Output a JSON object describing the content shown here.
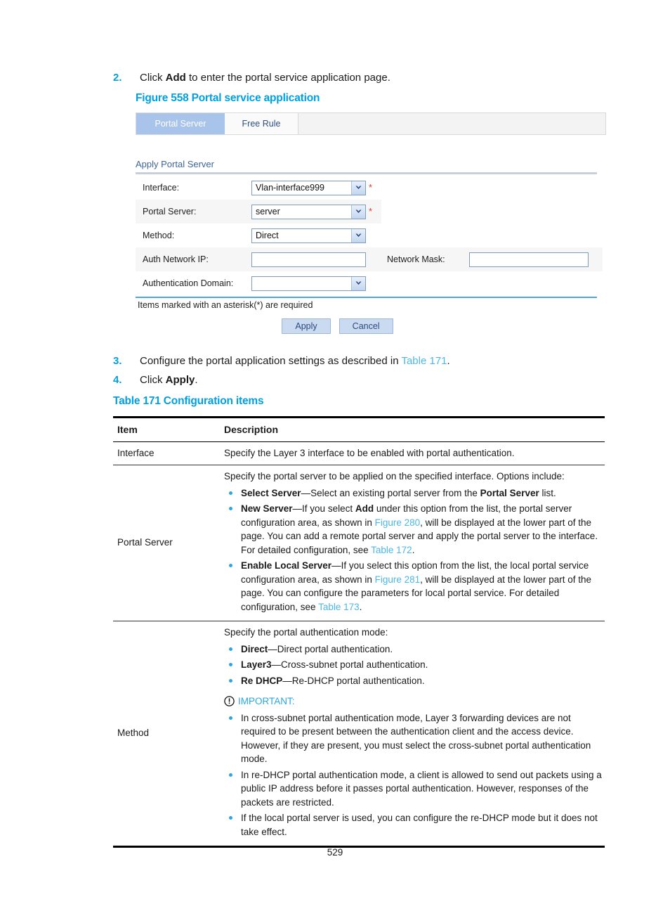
{
  "steps": {
    "step2": {
      "num": "2.",
      "pre": "Click ",
      "bold": "Add",
      "post": " to enter the portal service application page."
    },
    "step3": {
      "num": "3.",
      "pre": "Configure the portal application settings as described in ",
      "link": "Table 171",
      "post": "."
    },
    "step4": {
      "num": "4.",
      "pre": "Click ",
      "bold": "Apply",
      "post": "."
    }
  },
  "figure": {
    "caption": "Figure 558 Portal service application",
    "tabs": [
      {
        "label": "Portal Server",
        "active": true
      },
      {
        "label": "Free Rule",
        "active": false
      }
    ],
    "form": {
      "title": "Apply Portal Server",
      "fields": {
        "interface": {
          "label": "Interface:",
          "value": "Vlan-interface999",
          "required_mark": "*"
        },
        "portal_server": {
          "label": "Portal Server:",
          "value": "server",
          "required_mark": "*"
        },
        "method": {
          "label": "Method:",
          "value": "Direct"
        },
        "auth_network_ip": {
          "label": "Auth Network IP:",
          "value": ""
        },
        "network_mask": {
          "label": "Network Mask:",
          "value": ""
        },
        "authentication_domain": {
          "label": "Authentication Domain:",
          "value": ""
        }
      },
      "note": "Items marked with an asterisk(*) are required",
      "apply_label": "Apply",
      "cancel_label": "Cancel"
    }
  },
  "table": {
    "caption": "Table 171 Configuration items",
    "headers": {
      "item": "Item",
      "description": "Description"
    },
    "rows": {
      "interface": {
        "item": "Interface",
        "description": "Specify the Layer 3 interface to be enabled with portal authentication."
      },
      "portal_server": {
        "item": "Portal Server",
        "lead": "Specify the portal server to be applied on the specified interface. Options include:",
        "bullets": {
          "b1": {
            "bold": "Select Server",
            "t1": "—Select an existing portal server from the ",
            "bold2": "Portal Server",
            "t2": " list."
          },
          "b2": {
            "bold": "New Server",
            "t1": "—If you select ",
            "bold2": "Add",
            "t2": " under this option from the list, the portal server configuration area, as shown in ",
            "link1": "Figure 280",
            "t3": ", will be displayed at the lower part of the page. You can add a remote portal server and apply the portal server to the interface. For detailed configuration, see ",
            "link2": "Table 172",
            "t4": "."
          },
          "b3": {
            "bold": "Enable Local Server",
            "t1": "—If you select this option from the list, the local portal service configuration area, as shown in ",
            "link1": "Figure 281",
            "t2": ", will be displayed at the lower part of the page. You can configure the parameters for local portal service. For detailed configuration, see ",
            "link2": "Table 173",
            "t3": "."
          }
        }
      },
      "method": {
        "item": "Method",
        "lead": "Specify the portal authentication mode:",
        "bullets": {
          "b1": {
            "bold": "Direct",
            "t1": "—Direct portal authentication."
          },
          "b2": {
            "bold": "Layer3",
            "t1": "—Cross-subnet portal authentication."
          },
          "b3": {
            "bold": "Re DHCP",
            "t1": "—Re-DHCP portal authentication."
          }
        },
        "important_label": "IMPORTANT:",
        "important_bullets": {
          "i1": "In cross-subnet portal authentication mode, Layer 3 forwarding devices are not required to be present between the authentication client and the access device. However, if they are present, you must select the cross-subnet portal authentication mode.",
          "i2": "In re-DHCP portal authentication mode, a client is allowed to send out packets using a public IP address before it passes portal authentication. However, responses of the packets are restricted.",
          "i3": "If the local portal server is used, you can configure the re-DHCP mode but it does not take effect."
        }
      }
    }
  },
  "footer": {
    "page_number": "529"
  },
  "colors": {
    "accent": "#00a1de",
    "link": "#4cb8e8",
    "bullet": "#29a8e0",
    "tab_active_bg": "#a9c4ea",
    "required_star": "#e8352a",
    "button_bg": "#c9daf1"
  }
}
